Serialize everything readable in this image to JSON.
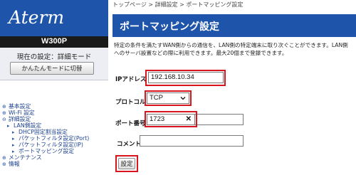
{
  "sidebar": {
    "logo": "Aterm",
    "model": "W300P",
    "current_setting": "現在の設定：詳細モード",
    "simple_mode_button": "かんたんモードに切替",
    "nav": [
      {
        "text": "基本設定",
        "prefix": "⊕"
      },
      {
        "text": "Wi-Fi 設定",
        "prefix": "⊕"
      },
      {
        "text": "詳細設定",
        "prefix": "⊖"
      },
      {
        "text": "LAN側設定",
        "prefix": "▸"
      },
      {
        "text": "DHCP固定割当設定",
        "prefix": "▸"
      },
      {
        "text": "パケットフィルタ設定(Port)",
        "prefix": "▸"
      },
      {
        "text": "パケットフィルタ設定(IP)",
        "prefix": "▸"
      },
      {
        "text": "ポートマッピング設定",
        "prefix": "▸"
      },
      {
        "text": "メンテナンス",
        "prefix": "⊕"
      },
      {
        "text": "情報",
        "prefix": "⊕"
      }
    ]
  },
  "main": {
    "breadcrumb": "トップページ > 詳細設定 > ポートマッピング設定",
    "title": "ポートマッピング設定",
    "description": "特定の条件を満たすWAN側からの通信を、LAN側の特定端末に取り次ぐことができます。LAN側へのサーバ設置などの際に利用できます。最大20個まで登録できます。"
  },
  "form": {
    "ip_label": "IPアドレス",
    "ip_value": "192.168.10.34",
    "protocol_label": "プロトコル",
    "protocol_value": "TCP",
    "port_label": "ポート番号",
    "port_value": "1723",
    "comment_label": "コメント",
    "comment_value": "",
    "submit_label": "設定"
  },
  "colors": {
    "brand_blue": "#1e55aa",
    "highlight_red": "#d8141c"
  },
  "icons": {
    "dropdown": "chevron-down-icon",
    "clear": "clear-x-icon",
    "expand": "plus-circle-icon",
    "collapse": "minus-circle-icon"
  }
}
